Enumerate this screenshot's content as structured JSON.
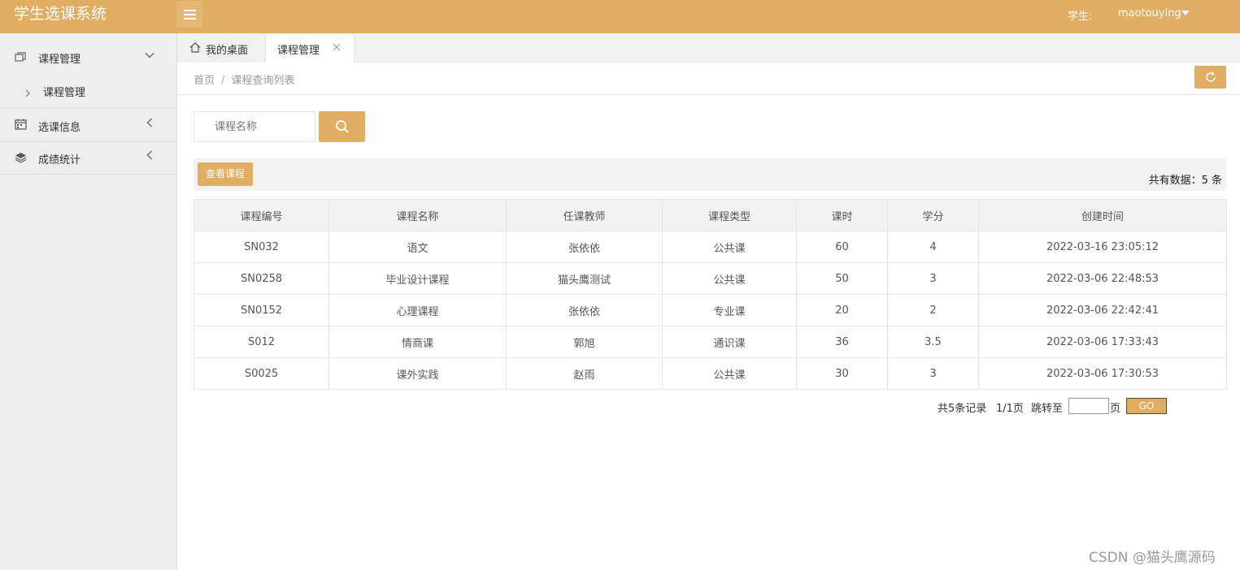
{
  "header": {
    "app_title": "学生选课系统",
    "user_role": "学生:",
    "user_name": "maotouying"
  },
  "sidebar": {
    "items": [
      {
        "label": "课程管理",
        "icon": "book-icon",
        "expanded": true,
        "children": [
          {
            "label": "课程管理"
          }
        ]
      },
      {
        "label": "选课信息",
        "icon": "calendar-icon",
        "expanded": false
      },
      {
        "label": "成绩统计",
        "icon": "layers-icon",
        "expanded": false
      }
    ]
  },
  "tabs": [
    {
      "label": "我的桌面",
      "icon": "home-icon",
      "active": false
    },
    {
      "label": "课程管理",
      "active": true,
      "closable": true
    }
  ],
  "breadcrumb": {
    "home": "首页",
    "separator": "/",
    "current": "课程查询列表"
  },
  "search": {
    "placeholder": "课程名称",
    "value": ""
  },
  "toolbar": {
    "view_button": "查看课程",
    "total_text": "共有数据：5 条"
  },
  "table": {
    "headers": [
      "课程编号",
      "课程名称",
      "任课教师",
      "课程类型",
      "课时",
      "学分",
      "创建时间"
    ],
    "rows": [
      [
        "SN032",
        "语文",
        "张依依",
        "公共课",
        "60",
        "4",
        "2022-03-16 23:05:12"
      ],
      [
        "SN0258",
        "毕业设计课程",
        "猫头鹰测试",
        "公共课",
        "50",
        "3",
        "2022-03-06 22:48:53"
      ],
      [
        "SN0152",
        "心理课程",
        "张依依",
        "专业课",
        "20",
        "2",
        "2022-03-06 22:42:41"
      ],
      [
        "S012",
        "情商课",
        "郭旭",
        "通识课",
        "36",
        "3.5",
        "2022-03-06 17:33:43"
      ],
      [
        "S0025",
        "课外实践",
        "赵雨",
        "公共课",
        "30",
        "3",
        "2022-03-06 17:30:53"
      ]
    ]
  },
  "pagination": {
    "records": "共5条记录",
    "pages": "1/1页",
    "jump_label": "跳转至",
    "page_unit": "页",
    "go": "GO",
    "input_value": ""
  },
  "watermark": "CSDN @猫头鹰源码",
  "colors": {
    "accent": "#e0ad63",
    "sidebar_bg": "#eeeeee",
    "table_header_bg": "#f2f2f2"
  }
}
